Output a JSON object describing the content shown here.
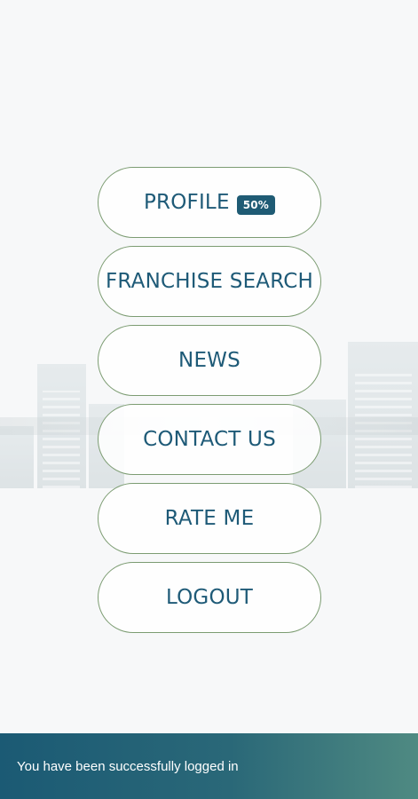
{
  "menu": {
    "profile_label": "PROFILE",
    "profile_badge": "50%",
    "franchise_search_label": "FRANCHISE SEARCH",
    "news_label": "NEWS",
    "contact_us_label": "CONTACT US",
    "rate_me_label": "RATE ME",
    "logout_label": "LOGOUT"
  },
  "snackbar": {
    "message": "You have been successfully logged in"
  },
  "colors": {
    "text_primary": "#1e5a77",
    "button_border": "#7c9c72",
    "badge_bg": "#1f5b74",
    "snackbar_start": "#1b5a74",
    "snackbar_end": "#4f8a82"
  }
}
